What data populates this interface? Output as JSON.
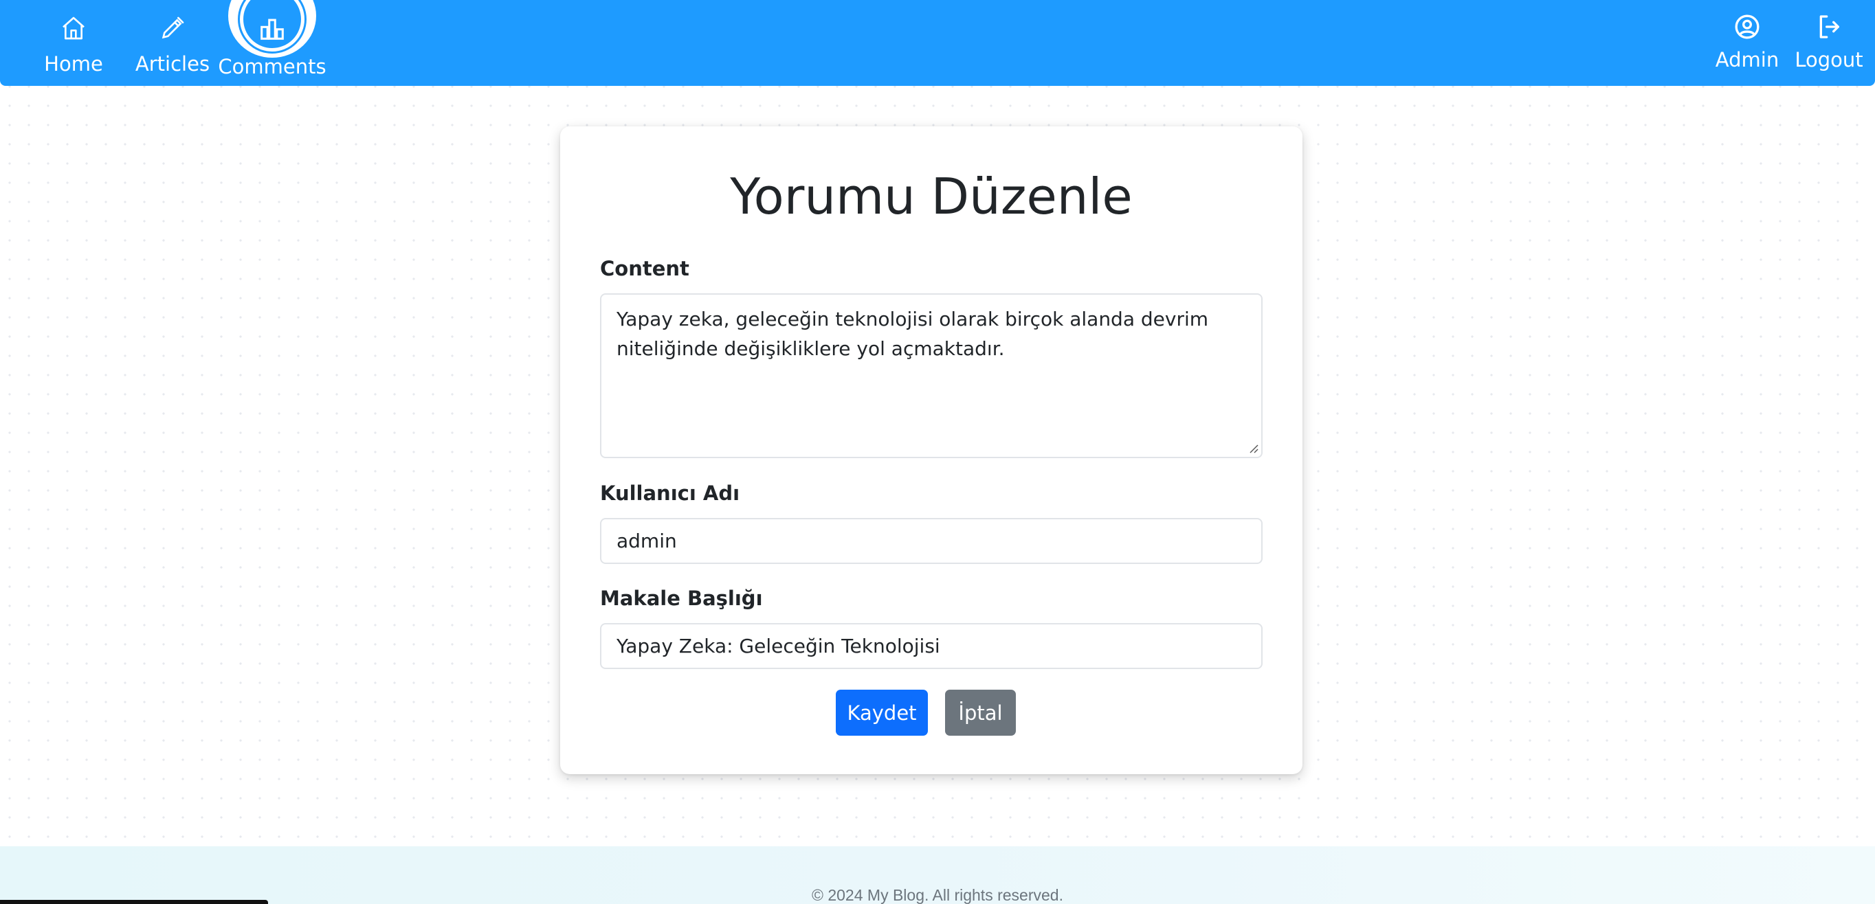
{
  "nav": {
    "home": {
      "label": "Home",
      "icon": "home-icon"
    },
    "articles": {
      "label": "Articles",
      "icon": "pen-icon"
    },
    "comments": {
      "label": "Comments",
      "icon": "bar-chart-icon"
    },
    "admin": {
      "label": "Admin",
      "icon": "user-circle-icon"
    },
    "logout": {
      "label": "Logout",
      "icon": "logout-icon"
    }
  },
  "form": {
    "title": "Yorumu Düzenle",
    "content_label": "Content",
    "content_value": "Yapay zeka, geleceğin teknolojisi olarak birçok alanda devrim niteliğinde değişikliklere yol açmaktadır.",
    "username_label": "Kullanıcı Adı",
    "username_value": "admin",
    "article_title_label": "Makale Başlığı",
    "article_title_value": "Yapay Zeka: Geleceğin Teknolojisi",
    "save_label": "Kaydet",
    "cancel_label": "İptal"
  },
  "footer": {
    "text": "© 2024 My Blog. All rights reserved."
  },
  "colors": {
    "navbar": "#1e9bff",
    "primary": "#0d6efd",
    "secondary": "#6c757d"
  }
}
